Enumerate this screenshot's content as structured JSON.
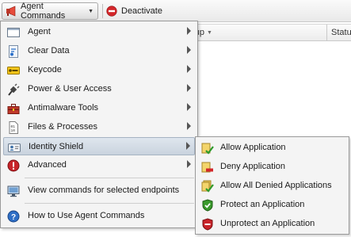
{
  "toolbar": {
    "agent_commands_label": "Agent Commands",
    "deactivate_label": "Deactivate"
  },
  "grid": {
    "group_column": "roup",
    "status_column": "Statu"
  },
  "menu": {
    "items": [
      {
        "label": "Agent",
        "icon": "window-icon"
      },
      {
        "label": "Clear Data",
        "icon": "clear-data-icon"
      },
      {
        "label": "Keycode",
        "icon": "keycode-icon"
      },
      {
        "label": "Power & User Access",
        "icon": "power-plug-icon"
      },
      {
        "label": "Antimalware Tools",
        "icon": "toolbox-icon"
      },
      {
        "label": "Files & Processes",
        "icon": "file-binary-icon"
      },
      {
        "label": "Identity Shield",
        "icon": "id-card-icon"
      },
      {
        "label": "Advanced",
        "icon": "alert-icon"
      },
      {
        "label": "View commands for selected endpoints",
        "icon": "monitor-icon"
      },
      {
        "label": "How to Use Agent Commands",
        "icon": "help-icon"
      }
    ]
  },
  "submenu": {
    "items": [
      {
        "label": "Allow Application",
        "icon": "allow-app-icon"
      },
      {
        "label": "Deny Application",
        "icon": "deny-app-icon"
      },
      {
        "label": "Allow All Denied Applications",
        "icon": "allow-all-icon"
      },
      {
        "label": "Protect an Application",
        "icon": "shield-check-icon"
      },
      {
        "label": "Unprotect an Application",
        "icon": "shield-remove-icon"
      }
    ]
  },
  "colors": {
    "highlight": "#c9d3de",
    "deny_red": "#d3262a",
    "protect_green": "#3a9a2c"
  }
}
